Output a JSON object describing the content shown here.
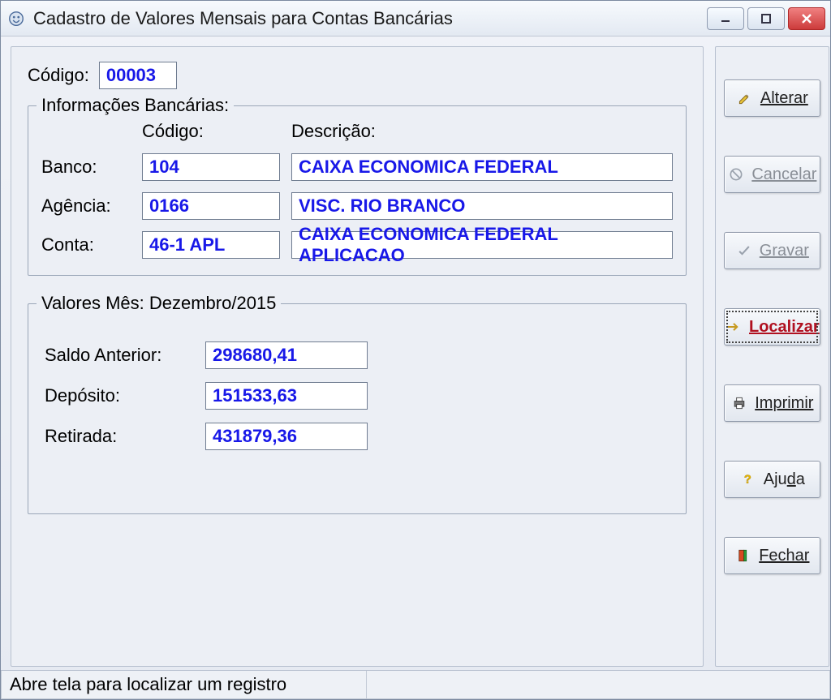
{
  "window": {
    "title": "Cadastro de Valores Mensais para Contas Bancárias"
  },
  "codigo": {
    "label": "Código:",
    "value": "00003"
  },
  "bank_info": {
    "group_title": "Informações Bancárias:",
    "header_codigo": "Código:",
    "header_descricao": "Descrição:",
    "banco_label": "Banco:",
    "banco_codigo": "104",
    "banco_descricao": "CAIXA ECONOMICA FEDERAL",
    "agencia_label": "Agência:",
    "agencia_codigo": "0166",
    "agencia_descricao": "VISC. RIO BRANCO",
    "conta_label": "Conta:",
    "conta_codigo": "46-1 APL",
    "conta_descricao": "CAIXA ECONOMICA FEDERAL APLICACAO"
  },
  "values": {
    "group_title": "Valores Mês: Dezembro/2015",
    "saldo_anterior_label": "Saldo Anterior:",
    "saldo_anterior": "298680,41",
    "deposito_label": "Depósito:",
    "deposito": "151533,63",
    "retirada_label": "Retirada:",
    "retirada": "431879,36"
  },
  "buttons": {
    "alterar": "Alterar",
    "cancelar": "Cancelar",
    "gravar": "Gravar",
    "localizar": "Localizar",
    "imprimir": "Imprimir",
    "ajuda": "Ajuda",
    "fechar": "Fechar"
  },
  "status": {
    "text": "Abre tela para localizar um registro"
  }
}
